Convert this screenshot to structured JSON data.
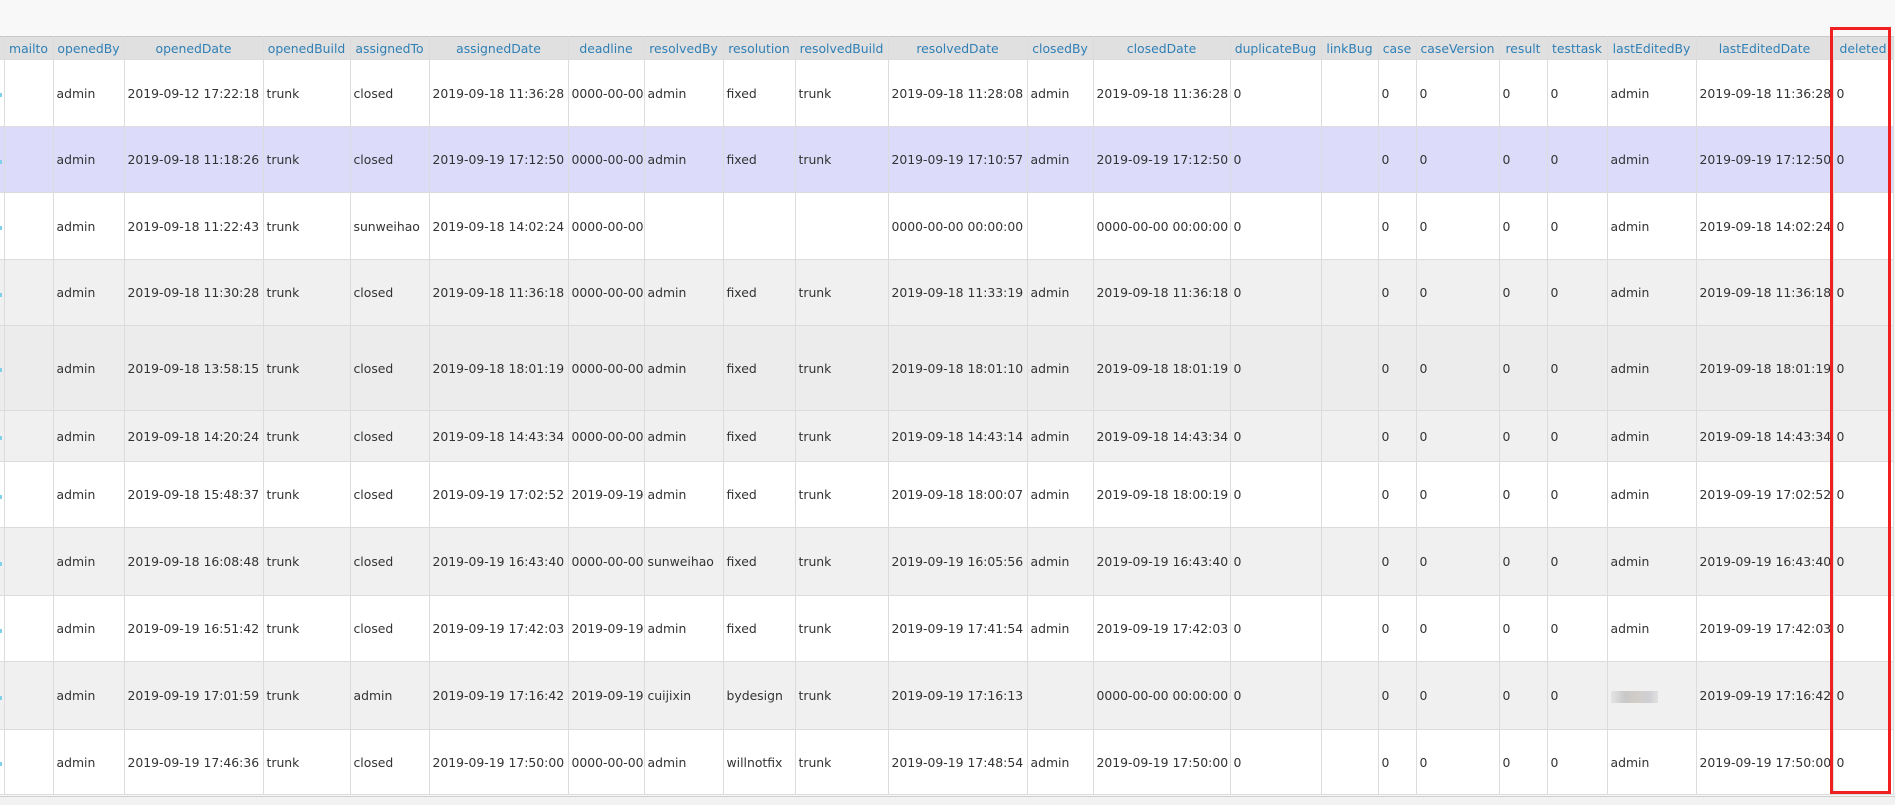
{
  "columns": [
    "",
    "mailto",
    "openedBy",
    "openedDate",
    "openedBuild",
    "assignedTo",
    "assignedDate",
    "deadline",
    "resolvedBy",
    "resolution",
    "resolvedBuild",
    "resolvedDate",
    "closedBy",
    "closedDate",
    "duplicateBug",
    "linkBug",
    "case",
    "caseVersion",
    "result",
    "testtask",
    "lastEditedBy",
    "lastEditedDate",
    "deleted"
  ],
  "highlighted_column": "deleted",
  "colors": {
    "highlight_box": "#f02020",
    "header_text": "#2f7fb5",
    "selected_row": "#dcdcfa"
  },
  "rows": [
    {
      "state": "odd",
      "cells": [
        "",
        "",
        "admin",
        "2019-09-12 17:22:18",
        "trunk",
        "closed",
        "2019-09-18 11:36:28",
        "0000-00-00",
        "admin",
        "fixed",
        "trunk",
        "2019-09-18 11:28:08",
        "admin",
        "2019-09-18 11:36:28",
        "0",
        "",
        "0",
        "0",
        "0",
        "0",
        "admin",
        "2019-09-18 11:36:28",
        "0"
      ]
    },
    {
      "state": "selected",
      "cells": [
        "",
        "",
        "admin",
        "2019-09-18 11:18:26",
        "trunk",
        "closed",
        "2019-09-19 17:12:50",
        "0000-00-00",
        "admin",
        "fixed",
        "trunk",
        "2019-09-19 17:10:57",
        "admin",
        "2019-09-19 17:12:50",
        "0",
        "",
        "0",
        "0",
        "0",
        "0",
        "admin",
        "2019-09-19 17:12:50",
        "0"
      ]
    },
    {
      "state": "odd",
      "cells": [
        "",
        "",
        "admin",
        "2019-09-18 11:22:43",
        "trunk",
        "sunweihao",
        "2019-09-18 14:02:24",
        "0000-00-00",
        "",
        "",
        "",
        "0000-00-00 00:00:00",
        "",
        "0000-00-00 00:00:00",
        "0",
        "",
        "0",
        "0",
        "0",
        "0",
        "admin",
        "2019-09-18 14:02:24",
        "0"
      ]
    },
    {
      "state": "even",
      "cells": [
        "",
        "",
        "admin",
        "2019-09-18 11:30:28",
        "trunk",
        "closed",
        "2019-09-18 11:36:18",
        "0000-00-00",
        "admin",
        "fixed",
        "trunk",
        "2019-09-18 11:33:19",
        "admin",
        "2019-09-18 11:36:18",
        "0",
        "",
        "0",
        "0",
        "0",
        "0",
        "admin",
        "2019-09-18 11:36:18",
        "0"
      ]
    },
    {
      "state": "hover",
      "cells": [
        "",
        "",
        "admin",
        "2019-09-18 13:58:15",
        "trunk",
        "closed",
        "2019-09-18 18:01:19",
        "0000-00-00",
        "admin",
        "fixed",
        "trunk",
        "2019-09-18 18:01:10",
        "admin",
        "2019-09-18 18:01:19",
        "0",
        "",
        "0",
        "0",
        "0",
        "0",
        "admin",
        "2019-09-18 18:01:19",
        "0"
      ]
    },
    {
      "state": "even",
      "cells": [
        "",
        "",
        "admin",
        "2019-09-18 14:20:24",
        "trunk",
        "closed",
        "2019-09-18 14:43:34",
        "0000-00-00",
        "admin",
        "fixed",
        "trunk",
        "2019-09-18 14:43:14",
        "admin",
        "2019-09-18 14:43:34",
        "0",
        "",
        "0",
        "0",
        "0",
        "0",
        "admin",
        "2019-09-18 14:43:34",
        "0"
      ]
    },
    {
      "state": "odd",
      "cells": [
        "",
        "",
        "admin",
        "2019-09-18 15:48:37",
        "trunk",
        "closed",
        "2019-09-19 17:02:52",
        "2019-09-19",
        "admin",
        "fixed",
        "trunk",
        "2019-09-18 18:00:07",
        "admin",
        "2019-09-18 18:00:19",
        "0",
        "",
        "0",
        "0",
        "0",
        "0",
        "admin",
        "2019-09-19 17:02:52",
        "0"
      ]
    },
    {
      "state": "even",
      "cells": [
        "",
        "",
        "admin",
        "2019-09-18 16:08:48",
        "trunk",
        "closed",
        "2019-09-19 16:43:40",
        "0000-00-00",
        "sunweihao",
        "fixed",
        "trunk",
        "2019-09-19 16:05:56",
        "admin",
        "2019-09-19 16:43:40",
        "0",
        "",
        "0",
        "0",
        "0",
        "0",
        "admin",
        "2019-09-19 16:43:40",
        "0"
      ]
    },
    {
      "state": "odd",
      "cells": [
        "",
        "",
        "admin",
        "2019-09-19 16:51:42",
        "trunk",
        "closed",
        "2019-09-19 17:42:03",
        "2019-09-19",
        "admin",
        "fixed",
        "trunk",
        "2019-09-19 17:41:54",
        "admin",
        "2019-09-19 17:42:03",
        "0",
        "",
        "0",
        "0",
        "0",
        "0",
        "admin",
        "2019-09-19 17:42:03",
        "0"
      ]
    },
    {
      "state": "even",
      "cells": [
        "",
        "",
        "admin",
        "2019-09-19 17:01:59",
        "trunk",
        "admin",
        "2019-09-19 17:16:42",
        "2019-09-19",
        "cuijixin",
        "bydesign",
        "trunk",
        "2019-09-19 17:16:13",
        "",
        "0000-00-00 00:00:00",
        "0",
        "",
        "0",
        "0",
        "0",
        "0",
        null,
        "2019-09-19 17:16:42",
        "0"
      ]
    },
    {
      "state": "odd",
      "cells": [
        "",
        "",
        "admin",
        "2019-09-19 17:46:36",
        "trunk",
        "closed",
        "2019-09-19 17:50:00",
        "0000-00-00",
        "admin",
        "willnotfix",
        "trunk",
        "2019-09-19 17:48:54",
        "admin",
        "2019-09-19 17:50:00",
        "0",
        "",
        "0",
        "0",
        "0",
        "0",
        "admin",
        "2019-09-19 17:50:00",
        "0"
      ]
    }
  ]
}
